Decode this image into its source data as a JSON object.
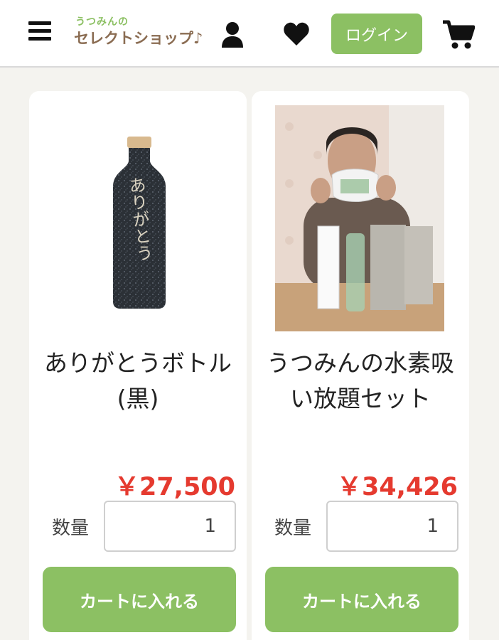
{
  "header": {
    "logo_top": "うつみんの",
    "logo_main": "セレクトショップ♪",
    "login_label": "ログイン",
    "icons": [
      "menu-icon",
      "user-icon",
      "heart-icon",
      "cart-icon"
    ]
  },
  "products": [
    {
      "name": "ありがとうボトル(黒)",
      "bottle_text": "ありがとう",
      "price": "￥27,500",
      "qty_label": "数量",
      "qty_value": "1",
      "add_to_cart": "カートに入れる"
    },
    {
      "name": "うつみんの水素吸い放題セット",
      "price": "￥34,426",
      "qty_label": "数量",
      "qty_value": "1",
      "add_to_cart": "カートに入れる"
    }
  ],
  "colors": {
    "accent_green": "#8cc063",
    "price_red": "#e53a2f",
    "logo_brown": "#8a6c52",
    "background": "#f4f3ef"
  }
}
